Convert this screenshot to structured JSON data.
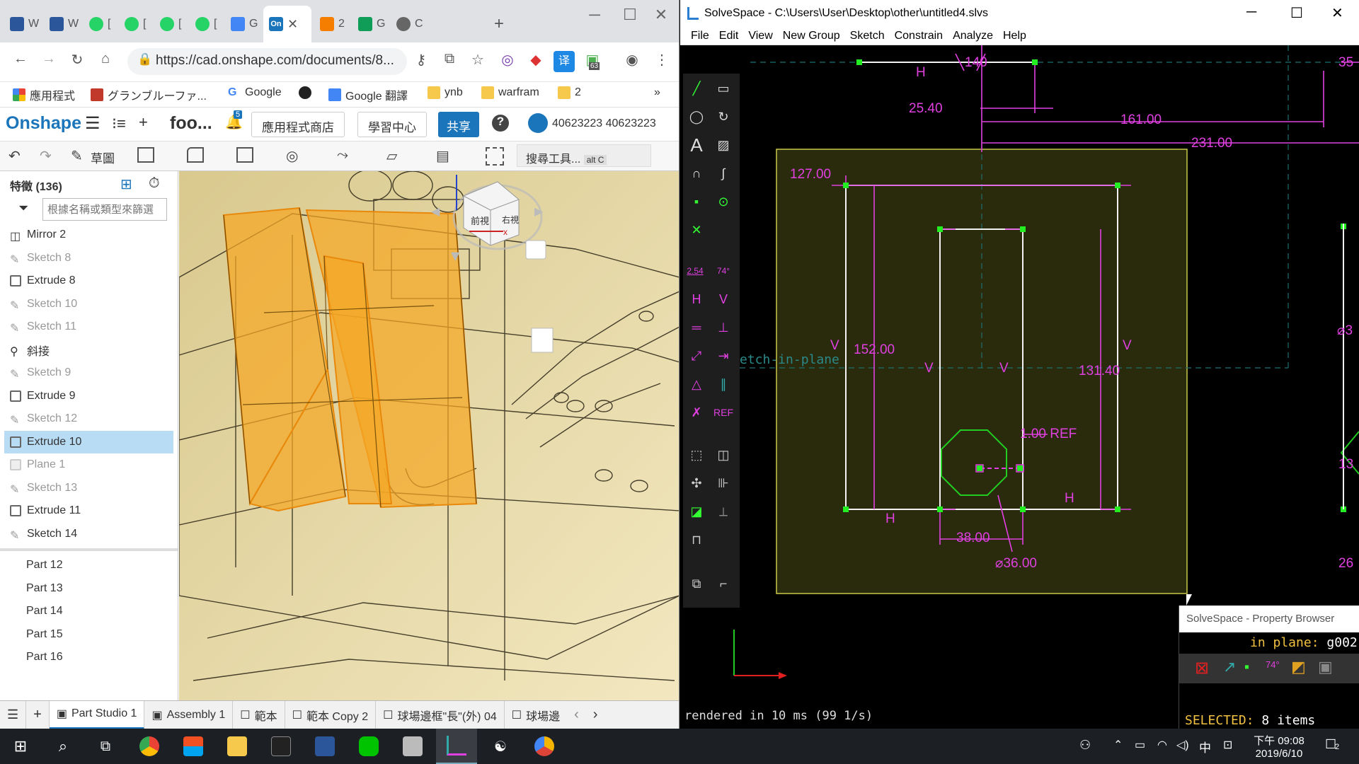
{
  "chrome": {
    "tabs": [
      "W",
      "W",
      "[",
      "[",
      "[",
      "[",
      "G",
      "On",
      "2",
      "G",
      "C"
    ],
    "new_tab": "+",
    "url": "https://cad.onshape.com/documents/8...",
    "bookmarks": [
      "應用程式",
      "グランブルーファ...",
      "Google",
      "Google 翻譯",
      "ynb",
      "warfram",
      "2"
    ],
    "bookmark_more": "»",
    "badge_count": "63"
  },
  "onshape": {
    "logo": "Onshape",
    "doc_name": "foo...",
    "notification_count": "5",
    "app_store": "應用程式商店",
    "learning": "學習中心",
    "share": "共享",
    "help": "?",
    "user": "40623223 40623223",
    "sketch_label": "草圖",
    "search_tools": "搜尋工具...",
    "search_shortcut": "alt C",
    "features_title": "特徵 (136)",
    "filter_placeholder": "根據名稱或類型來篩選",
    "features": [
      {
        "label": "Mirror 2",
        "icon": "mirror-icon",
        "dim": false
      },
      {
        "label": "Sketch 8",
        "icon": "sketch-icon",
        "dim": true
      },
      {
        "label": "Extrude 8",
        "icon": "extrude-icon",
        "dim": false
      },
      {
        "label": "Sketch 10",
        "icon": "sketch-icon",
        "dim": true
      },
      {
        "label": "Sketch 11",
        "icon": "sketch-icon",
        "dim": true
      },
      {
        "label": "斜接",
        "icon": "chamfer-icon",
        "dim": false
      },
      {
        "label": "Sketch 9",
        "icon": "sketch-icon",
        "dim": true
      },
      {
        "label": "Extrude 9",
        "icon": "extrude-icon",
        "dim": false
      },
      {
        "label": "Sketch 12",
        "icon": "sketch-icon",
        "dim": true
      },
      {
        "label": "Extrude 10",
        "icon": "extrude-icon",
        "dim": false,
        "selected": true
      },
      {
        "label": "Plane 1",
        "icon": "plane-icon",
        "dim": true
      },
      {
        "label": "Sketch 13",
        "icon": "sketch-icon",
        "dim": true
      },
      {
        "label": "Extrude 11",
        "icon": "extrude-icon",
        "dim": false
      },
      {
        "label": "Sketch 14",
        "icon": "sketch-icon",
        "dim": false
      }
    ],
    "parts": [
      "Part 12",
      "Part 13",
      "Part 14",
      "Part 15",
      "Part 16"
    ],
    "view_cube": {
      "front": "前視",
      "right": "右視"
    },
    "bottom_tabs": [
      "Part Studio 1",
      "Assembly 1",
      "範本",
      "範本 Copy 2",
      "球場邊框\"長\"(外) 04",
      "球場邊"
    ]
  },
  "solvespace": {
    "title": "SolveSpace - C:\\Users\\User\\Desktop\\other\\untitled4.slvs",
    "menu": [
      "File",
      "Edit",
      "View",
      "New Group",
      "Sketch",
      "Constrain",
      "Analyze",
      "Help"
    ],
    "status": "rendered in 10 ms (99 1/s)",
    "workplane_label": "etch-in-plane",
    "dimensions": {
      "d1": "127.00",
      "d2": "152.00",
      "d3": "131.40",
      "d4": "1.00  REF",
      "d5": "38.00",
      "d6": "⌀36.00",
      "d7": "25.40",
      "d8": "161.00",
      "d9": "231.00",
      "d10": "140",
      "d11": "35",
      "d12": "⌀3",
      "d13": "13",
      "d14": "26"
    },
    "constraint_labels": {
      "h": "H",
      "v": "V",
      "ref": "REF"
    },
    "property_browser": {
      "title": "SolveSpace - Property Browser",
      "in_plane": "in plane:",
      "plane_id": "g002",
      "selected": "SELECTED:",
      "selected_count": "8 items"
    },
    "toolbar_labels": {
      "dist": "2.54",
      "angle": "74°",
      "ref": "REF"
    }
  },
  "taskbar": {
    "time": "下午 09:08",
    "date": "2019/6/10",
    "ime": "中",
    "notif": "2"
  },
  "colors": {
    "onshape_blue": "#1b75bb",
    "ss_dim": "#e040e0",
    "ss_point": "#22ee22",
    "ss_line": "#ffffff",
    "orange_face": "#f5a623"
  }
}
